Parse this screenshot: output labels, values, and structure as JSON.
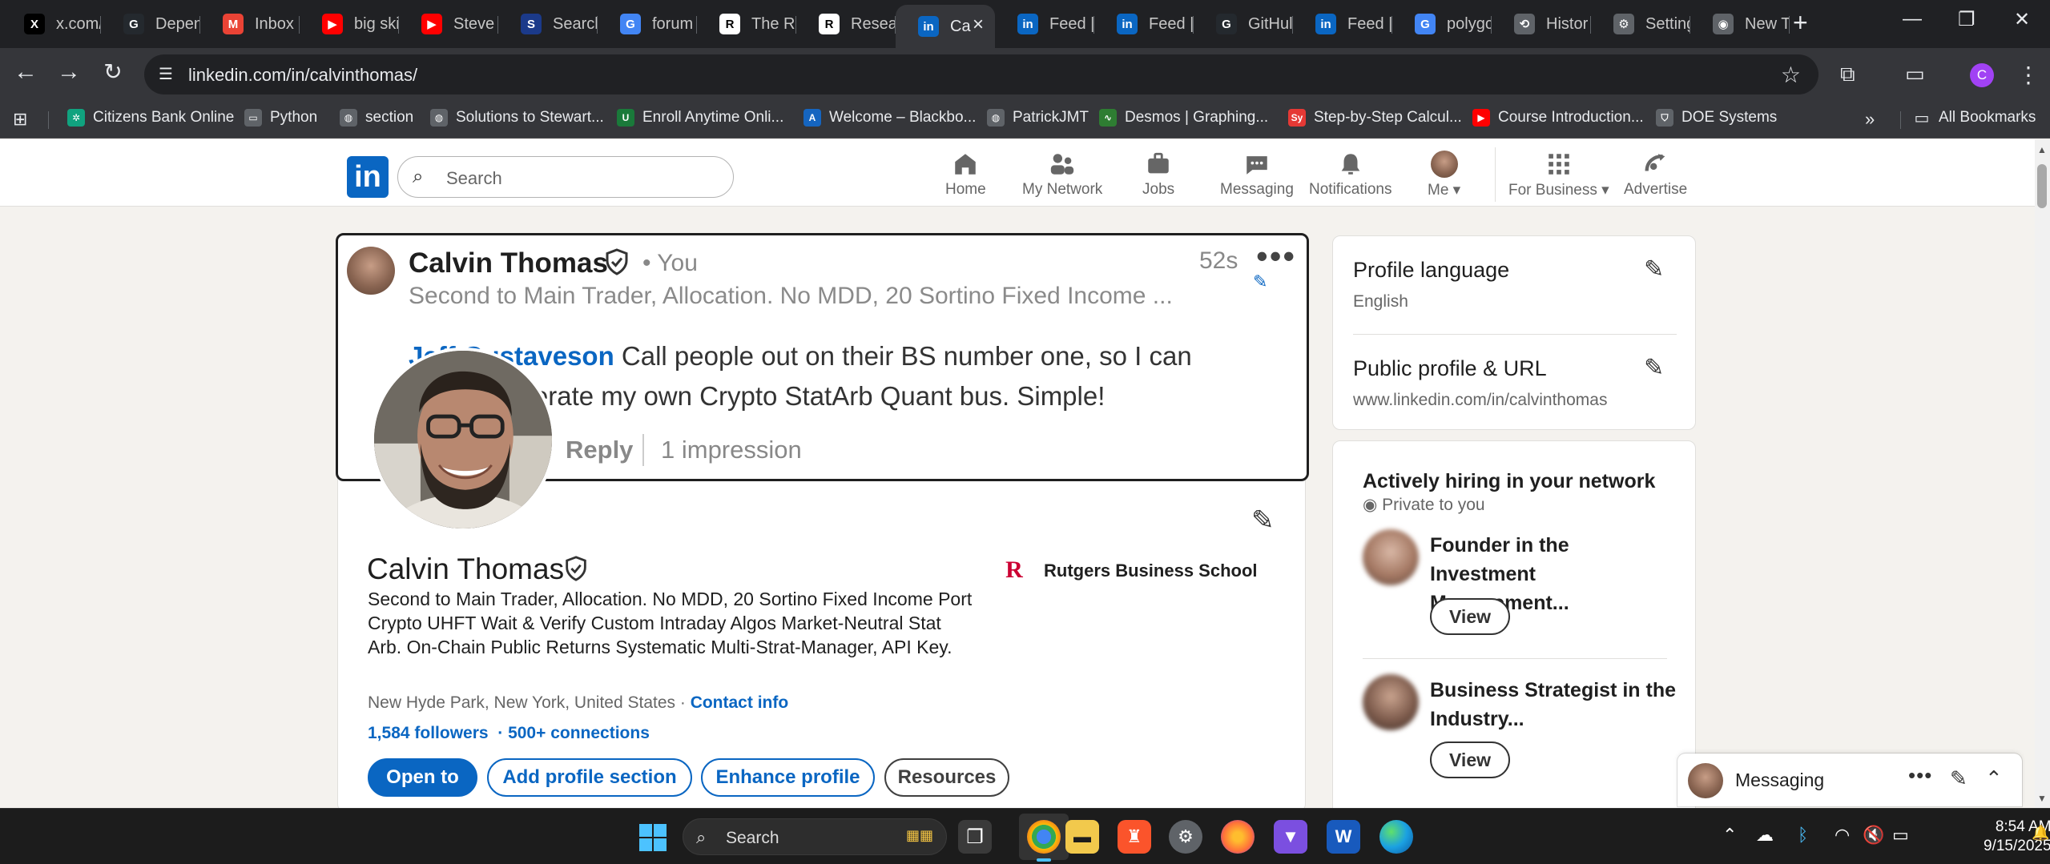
{
  "browser": {
    "tabs": [
      {
        "label": "x.com/",
        "icon": "x-icon",
        "color": "#000000",
        "glyph": "X"
      },
      {
        "label": "Depen",
        "icon": "github-icon",
        "color": "#24292e",
        "glyph": "G"
      },
      {
        "label": "Inbox",
        "icon": "gmail-icon",
        "color": "#ea4335",
        "glyph": "M"
      },
      {
        "label": "big ski",
        "icon": "youtube-icon",
        "color": "#ff0000",
        "glyph": "▶"
      },
      {
        "label": "Steve",
        "icon": "youtube-icon",
        "color": "#ff0000",
        "glyph": "▶"
      },
      {
        "label": "Search",
        "icon": "ssrn-icon",
        "color": "#1b3a8a",
        "glyph": "S"
      },
      {
        "label": "forum",
        "icon": "google-icon",
        "color": "#4285f4",
        "glyph": "G"
      },
      {
        "label": "The Re",
        "icon": "researchgate-icon",
        "color": "#ffffff",
        "glyph": "R"
      },
      {
        "label": "Resear",
        "icon": "researchgate-icon",
        "color": "#ffffff",
        "glyph": "R"
      },
      {
        "label": "Ca",
        "icon": "linkedin-icon",
        "color": "#0a66c2",
        "glyph": "in",
        "active": true
      },
      {
        "label": "Feed |",
        "icon": "linkedin-icon",
        "color": "#0a66c2",
        "glyph": "in"
      },
      {
        "label": "Feed |",
        "icon": "linkedin-icon",
        "color": "#0a66c2",
        "glyph": "in"
      },
      {
        "label": "GitHul",
        "icon": "github-icon",
        "color": "#24292e",
        "glyph": "G"
      },
      {
        "label": "Feed |",
        "icon": "linkedin-icon",
        "color": "#0a66c2",
        "glyph": "in"
      },
      {
        "label": "polygc",
        "icon": "google-icon",
        "color": "#4285f4",
        "glyph": "G"
      },
      {
        "label": "Histor",
        "icon": "history-icon",
        "color": "#5f6368",
        "glyph": "⟲"
      },
      {
        "label": "Setting",
        "icon": "settings-icon",
        "color": "#5f6368",
        "glyph": "⚙"
      },
      {
        "label": "New T",
        "icon": "chrome-icon",
        "color": "#5f6368",
        "glyph": "◉"
      }
    ],
    "url": "linkedin.com/in/calvinthomas/",
    "profile_initial": "C",
    "bookmarks": [
      {
        "label": "Citizens Bank Online",
        "color": "#10a37f",
        "glyph": "✲"
      },
      {
        "label": "Python",
        "color": "#5f6368",
        "glyph": "▭"
      },
      {
        "label": "section",
        "color": "#5f6368",
        "glyph": "◍"
      },
      {
        "label": "Solutions to Stewart...",
        "color": "#5f6368",
        "glyph": "◍"
      },
      {
        "label": "Enroll Anytime Onli...",
        "color": "#1a7a3a",
        "glyph": "U"
      },
      {
        "label": "Welcome – Blackbo...",
        "color": "#1565c0",
        "glyph": "A"
      },
      {
        "label": "PatrickJMT",
        "color": "#5f6368",
        "glyph": "◍"
      },
      {
        "label": "Desmos | Graphing...",
        "color": "#2e7d32",
        "glyph": "∿"
      },
      {
        "label": "Step-by-Step Calcul...",
        "color": "#e53935",
        "glyph": "Sy"
      },
      {
        "label": "Course Introduction...",
        "color": "#ff0000",
        "glyph": "▶"
      },
      {
        "label": "DOE Systems",
        "color": "#5f6368",
        "glyph": "⛉"
      }
    ],
    "all_bookmarks": "All Bookmarks"
  },
  "linkedin": {
    "search_placeholder": "Search",
    "nav": [
      {
        "label": "Home",
        "icon": "home-icon"
      },
      {
        "label": "My Network",
        "icon": "my-network-icon"
      },
      {
        "label": "Jobs",
        "icon": "jobs-icon"
      },
      {
        "label": "Messaging",
        "icon": "messaging-icon"
      },
      {
        "label": "Notifications",
        "icon": "notifications-icon"
      },
      {
        "label": "Me",
        "icon": "me-avatar"
      },
      {
        "label": "For Business",
        "icon": "grid-icon"
      },
      {
        "label": "Advertise",
        "icon": "advertise-icon"
      }
    ]
  },
  "comment_popup": {
    "name": "Calvin Thomas",
    "you": "• You",
    "time": "52s",
    "headline": "Second to Main Trader, Allocation. No MDD, 20 Sortino Fixed Income ...",
    "mention": "Jeff Gustaveson",
    "comment_text": " Call people out on their BS number one, so I can actively operate my own Crypto StatArb Quant bus. Simple!",
    "reply": "Reply",
    "impressions": "1 impression"
  },
  "profile": {
    "name": "Calvin Thomas",
    "headline": "Second to Main Trader, Allocation. No MDD, 20 Sortino Fixed Income Port Crypto UHFT Wait & Verify Custom Intraday Algos Market-Neutral Stat Arb. On-Chain Public Returns Systematic Multi-Strat-Manager, API Key.",
    "location": "New Hyde Park, New York, United States",
    "location_sep": " · ",
    "contact_info": "Contact info",
    "followers": "1,584 followers",
    "connections": "· 500+ connections",
    "school": "Rutgers Business School",
    "school_logo": "R",
    "buttons": {
      "open_to": "Open to",
      "add_section": "Add profile section",
      "enhance": "Enhance profile",
      "resources": "Resources"
    }
  },
  "right_rail": {
    "profile_language_title": "Profile language",
    "profile_language_value": "English",
    "public_profile_title": "Public profile & URL",
    "public_profile_url": "www.linkedin.com/in/calvinthomas",
    "hiring_title": "Actively hiring in your network",
    "hiring_private": "Private to you",
    "jobs": [
      {
        "title": "Founder in the Investment Management...",
        "button": "View"
      },
      {
        "title": "Business Strategist in the Industry...",
        "button": "View"
      }
    ]
  },
  "messaging": {
    "label": "Messaging"
  },
  "taskbar": {
    "search": "Search",
    "time": "8:54 AM",
    "date": "9/15/2025"
  }
}
